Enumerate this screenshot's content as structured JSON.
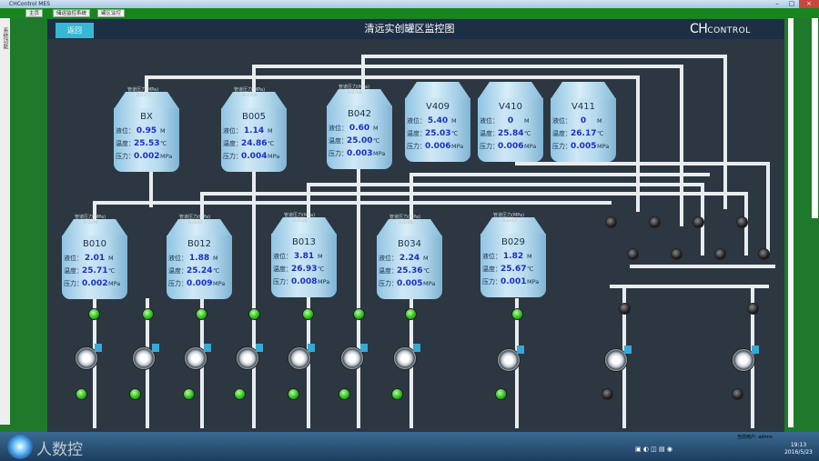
{
  "window": {
    "title": "CHControl MES",
    "min": "–",
    "max": "□",
    "close": "×"
  },
  "tabs": [
    "主页",
    "储运监控系统",
    "罐区监控"
  ],
  "sidebar_label": "系统功能",
  "header": {
    "back_button": "返回",
    "title": "清远实创罐区监控图",
    "logo_main": "CH",
    "logo_sub": "CONTROL"
  },
  "labels": {
    "level": "液位：",
    "temp": "温度：",
    "pressure": "压力：",
    "pressure_gauge": "管道压力(MPa)"
  },
  "units": {
    "level": "M",
    "temp": "℃",
    "pressure": "MPa"
  },
  "tanks": [
    {
      "name": "BX",
      "level": "0.95",
      "temp": "25.53",
      "pressure": "0.002",
      "gauge": "0.0371"
    },
    {
      "name": "B005",
      "level": "1.14",
      "temp": "24.86",
      "pressure": "0.004",
      "gauge": "0.0709"
    },
    {
      "name": "B042",
      "level": "0.60",
      "temp": "25.00",
      "pressure": "0.003",
      "gauge": "0.0768"
    },
    {
      "name": "V409",
      "level": "5.40",
      "temp": "25.03",
      "pressure": "0.006",
      "gauge": ""
    },
    {
      "name": "V410",
      "level": "0",
      "temp": "25.84",
      "pressure": "0.006",
      "gauge": ""
    },
    {
      "name": "V411",
      "level": "0",
      "temp": "26.17",
      "pressure": "0.005",
      "gauge": ""
    },
    {
      "name": "B010",
      "level": "2.01",
      "temp": "25.71",
      "pressure": "0.002",
      "gauge": "0.0694"
    },
    {
      "name": "B012",
      "level": "1.88",
      "temp": "25.24",
      "pressure": "0.009",
      "gauge": "0.0681"
    },
    {
      "name": "B013",
      "level": "3.81",
      "temp": "26.93",
      "pressure": "0.008",
      "gauge": "0.0526"
    },
    {
      "name": "B034",
      "level": "2.24",
      "temp": "25.36",
      "pressure": "0.005",
      "gauge": "0.0289"
    },
    {
      "name": "B029",
      "level": "1.82",
      "temp": "25.67",
      "pressure": "0.001",
      "gauge": "0.0443"
    }
  ],
  "taskbar": {
    "watermark": "人数控",
    "time": "19:13",
    "date": "2016/5/23",
    "status": "当前用户: admin"
  }
}
